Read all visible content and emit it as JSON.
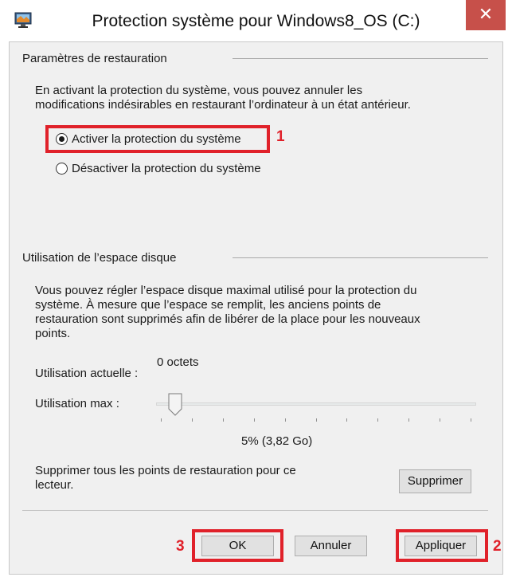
{
  "window": {
    "title": "Protection système pour Windows8_OS (C:)",
    "close_label": "✕"
  },
  "restore_settings": {
    "group_title": "Paramètres de restauration",
    "description_line1": "En activant la protection du système, vous pouvez annuler les",
    "description_line2": "modifications indésirables en restaurant l’ordinateur à un état antérieur.",
    "options": [
      {
        "label": "Activer la protection du système",
        "selected": true
      },
      {
        "label": "Désactiver la protection du système",
        "selected": false
      }
    ]
  },
  "disk_usage": {
    "group_title": "Utilisation de l’espace disque",
    "description_lines": [
      "Vous pouvez régler l’espace disque maximal utilisé pour la protection du",
      "système. À mesure que l’espace se remplit, les anciens points de",
      "restauration sont supprimés afin de libérer de la place pour les nouveaux",
      "points."
    ],
    "current_usage_label": "Utilisation actuelle :",
    "current_usage_value": "0 octets",
    "max_usage_label": "Utilisation max :",
    "max_usage_percent": 5,
    "max_usage_display": "5% (3,82 Go)",
    "delete_text_line1": "Supprimer tous les points de restauration pour ce",
    "delete_text_line2": "lecteur.",
    "delete_button": "Supprimer"
  },
  "buttons": {
    "ok": "OK",
    "cancel": "Annuler",
    "apply": "Appliquer"
  },
  "annotations": {
    "marker_1": "1",
    "marker_2": "2",
    "marker_3": "3",
    "color": "#e0212a"
  }
}
